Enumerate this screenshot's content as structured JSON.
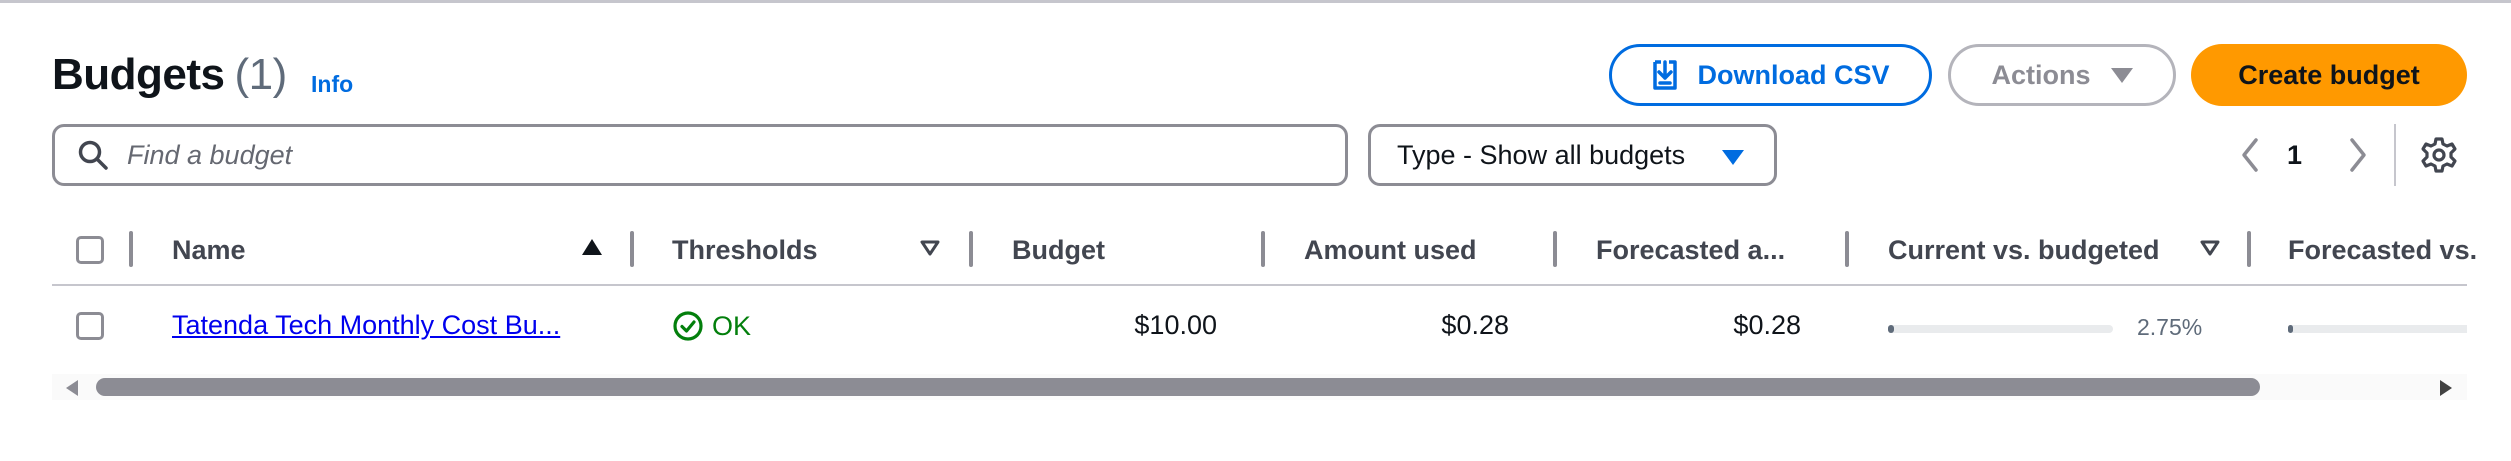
{
  "header": {
    "title": "Budgets",
    "count": "(1)",
    "info_label": "Info",
    "download_label": "Download CSV",
    "actions_label": "Actions",
    "create_label": "Create budget"
  },
  "search": {
    "placeholder": "Find a budget",
    "value": ""
  },
  "filter": {
    "selected": "Type - Show all budgets"
  },
  "pagination": {
    "current_page": "1"
  },
  "icons": {
    "download": "download-icon",
    "search": "search-icon",
    "caret": "caret-down-icon",
    "prev": "chevron-left-icon",
    "next": "chevron-right-icon",
    "settings": "gear-icon",
    "status_ok": "check-circle-icon",
    "sort_asc": "sort-ascending-icon",
    "sort_desc": "sort-descending-icon"
  },
  "colors": {
    "accent": "#006ce0",
    "primary_button": "#ff9900",
    "status_ok": "#037f0c",
    "link": "#0000ee"
  },
  "table": {
    "columns": [
      {
        "label": "Name"
      },
      {
        "label": "Thresholds"
      },
      {
        "label": "Budget"
      },
      {
        "label": "Amount used"
      },
      {
        "label": "Forecasted a..."
      },
      {
        "label": "Current vs. budgeted"
      },
      {
        "label": "Forecasted vs."
      }
    ],
    "rows": [
      {
        "name": "Tatenda Tech Monthly Cost Bu...",
        "threshold_status": "OK",
        "budget": "$10.00",
        "amount_used": "$0.28",
        "forecasted": "$0.28",
        "current_vs_budgeted_pct": "2.75%",
        "current_vs_budgeted_fraction": 0.0275,
        "forecasted_vs_budgeted_fraction": 0.0275
      }
    ]
  }
}
